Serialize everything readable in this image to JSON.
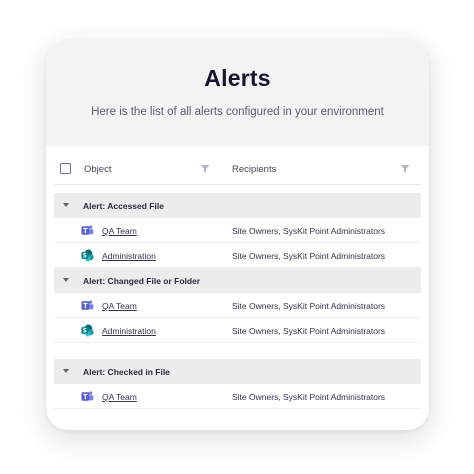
{
  "header": {
    "title": "Alerts",
    "subtitle": "Here is the list of all alerts configured in your environment"
  },
  "columns": {
    "object": "Object",
    "recipients": "Recipients"
  },
  "groups": [
    {
      "label": "Alert: Accessed File",
      "rows": [
        {
          "object": "QA Team",
          "icon": "teams-icon",
          "recipients": "Site Owners, SysKit Point Administrators"
        },
        {
          "object": "Administration",
          "icon": "sharepoint-icon",
          "recipients": "Site Owners, SysKit Point Administrators"
        }
      ]
    },
    {
      "label": "Alert: Changed File or Folder",
      "rows": [
        {
          "object": "QA Team",
          "icon": "teams-icon",
          "recipients": "Site Owners, SysKit Point Administrators"
        },
        {
          "object": "Administration",
          "icon": "sharepoint-icon",
          "recipients": "Site Owners, SysKit Point Administrators"
        }
      ]
    },
    {
      "label": "Alert: Checked in File",
      "rows": [
        {
          "object": "QA Team",
          "icon": "teams-icon",
          "recipients": "Site Owners, SysKit Point Administrators"
        }
      ]
    }
  ],
  "colors": {
    "teams": "#5b5fc7",
    "sharepoint": "#038387",
    "title": "#15152b"
  }
}
